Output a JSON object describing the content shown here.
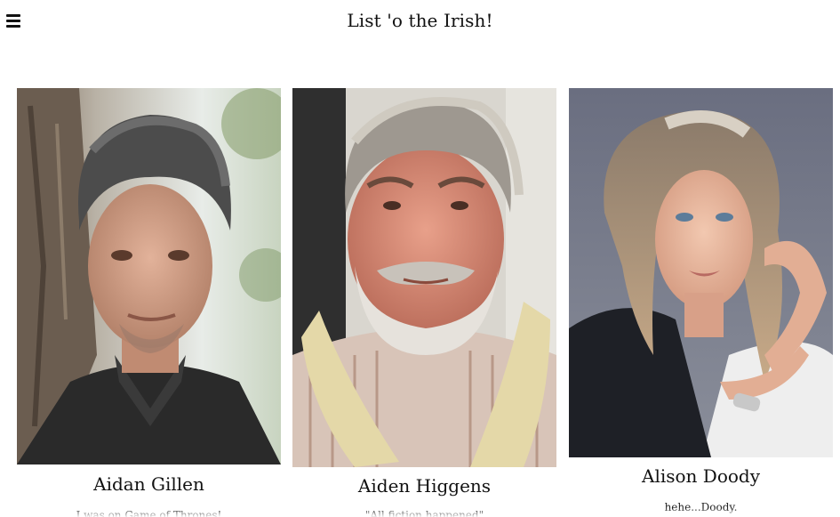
{
  "header": {
    "title": "List 'o the Irish!",
    "menu_icon": "hamburger-menu-icon"
  },
  "people": [
    {
      "name": "Aidan Gillen",
      "quote": "I was on Game of Thrones!",
      "photo_icon": "portrait-photo"
    },
    {
      "name": "Aiden Higgens",
      "quote": "\"All fiction happened\"",
      "photo_icon": "portrait-photo"
    },
    {
      "name": "Alison Doody",
      "quote": "hehe...Doody.",
      "photo_icon": "portrait-photo"
    }
  ]
}
